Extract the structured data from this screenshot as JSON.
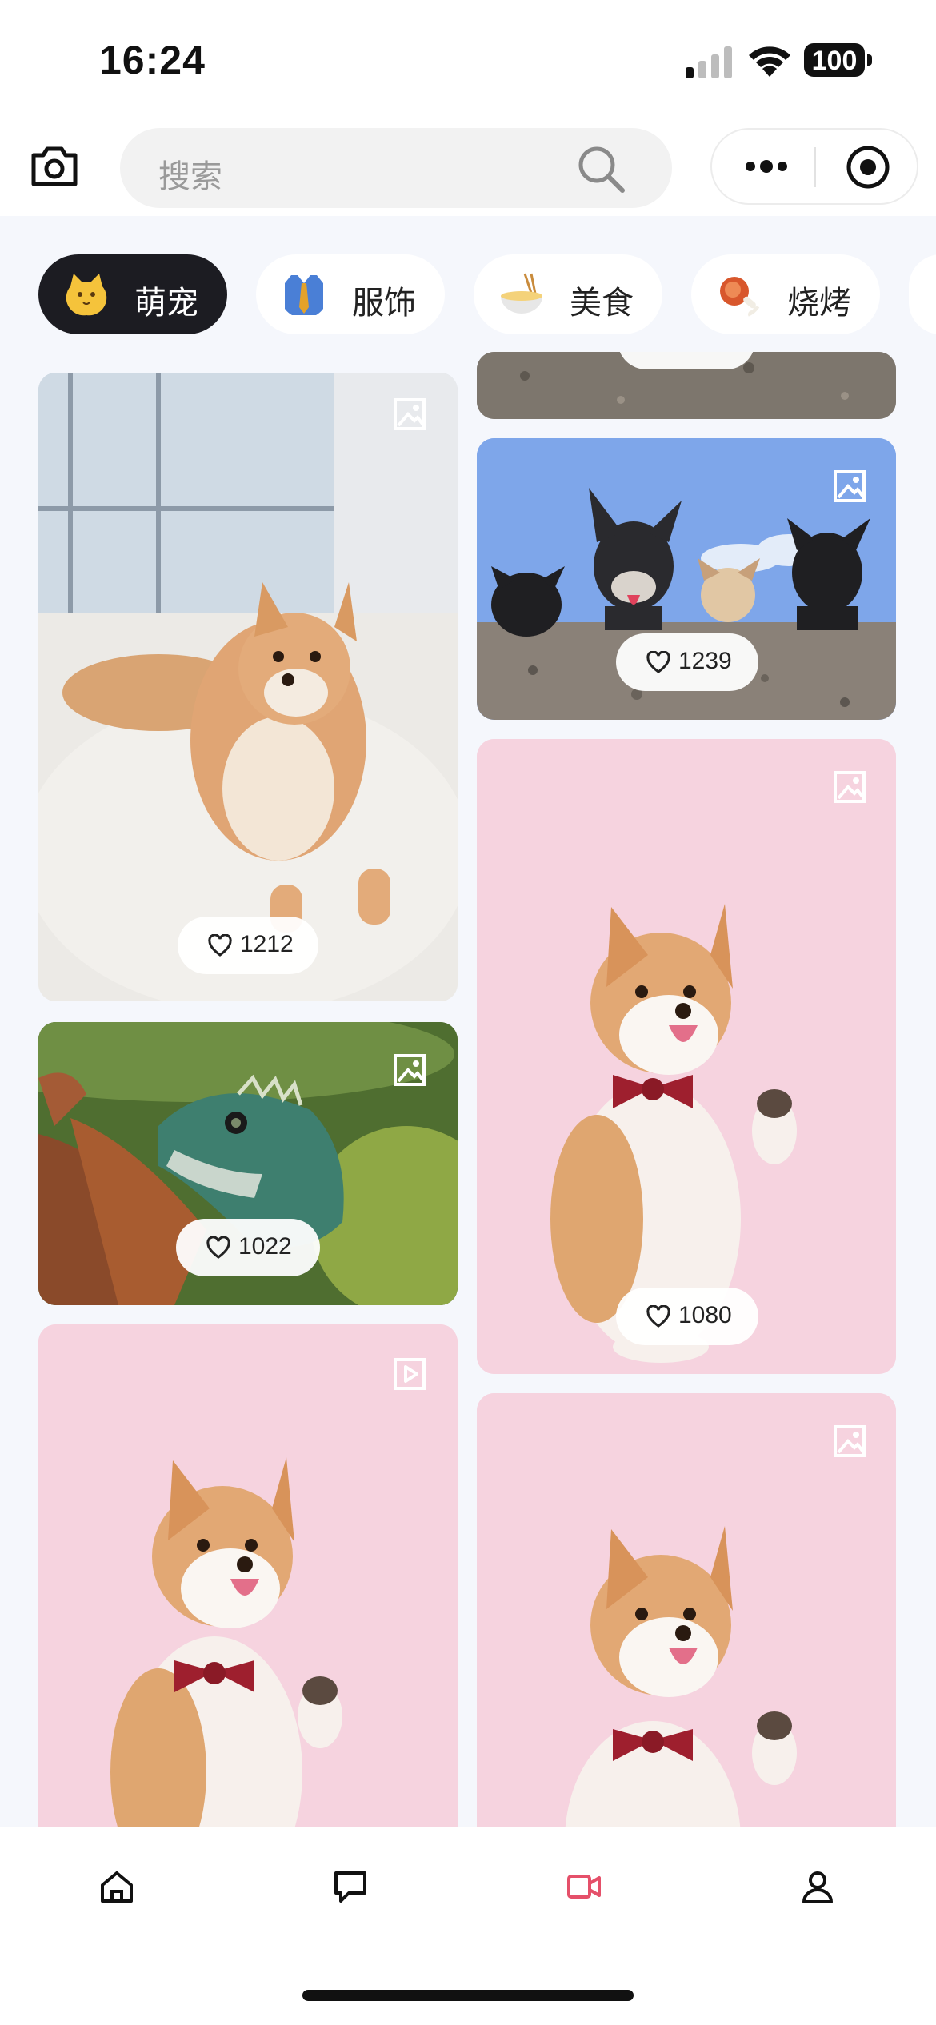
{
  "status": {
    "time": "16:24",
    "battery": "100"
  },
  "search": {
    "placeholder": "搜索"
  },
  "categories": [
    {
      "label": "萌宠",
      "icon": "cat-emoji-icon",
      "active": true
    },
    {
      "label": "服饰",
      "icon": "shirt-tie-emoji-icon",
      "active": false
    },
    {
      "label": "美食",
      "icon": "noodles-emoji-icon",
      "active": false
    },
    {
      "label": "烧烤",
      "icon": "meat-on-bone-emoji-icon",
      "active": false
    }
  ],
  "feed": {
    "left": [
      {
        "type": "image",
        "subject": "shiba-on-rug",
        "likes": "1212"
      },
      {
        "type": "image",
        "subject": "lizard",
        "likes": "1022"
      },
      {
        "type": "video",
        "subject": "shiba-bowtie-pink",
        "likes": ""
      }
    ],
    "right": [
      {
        "type": "image",
        "subject": "dogs-on-wall-partial",
        "likes": ""
      },
      {
        "type": "image",
        "subject": "four-dogs-on-wall",
        "likes": "1239"
      },
      {
        "type": "image",
        "subject": "shiba-bowtie-pink",
        "likes": "1080"
      },
      {
        "type": "image",
        "subject": "shiba-bowtie-pink",
        "likes": ""
      }
    ]
  },
  "tabbar": {
    "items": [
      "home-icon",
      "chat-icon",
      "video-icon",
      "profile-icon"
    ],
    "active": "video-icon",
    "active_color": "#e5506a"
  },
  "colors": {
    "active_chip_bg": "#1c1c22",
    "page_bg": "#f5f7fc",
    "pink_bg": "#f6d3df"
  }
}
